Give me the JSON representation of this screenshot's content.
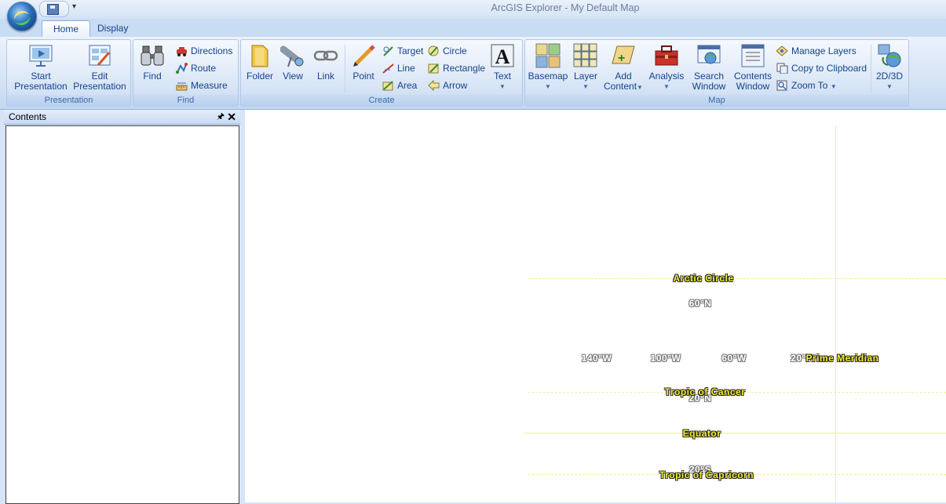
{
  "window": {
    "title": "ArcGIS Explorer - My Default Map"
  },
  "quick_access": {
    "more": "▾"
  },
  "tabs": [
    {
      "label": "Home",
      "active": true
    },
    {
      "label": "Display",
      "active": false
    }
  ],
  "groups": {
    "presentation": {
      "label": "Presentation",
      "start_line1": "Start",
      "start_line2": "Presentation",
      "edit_line1": "Edit",
      "edit_line2": "Presentation"
    },
    "find": {
      "label": "Find",
      "find": "Find",
      "directions": "Directions",
      "route": "Route",
      "measure": "Measure"
    },
    "create": {
      "label": "Create",
      "folder": "Folder",
      "view": "View",
      "link": "Link",
      "point": "Point",
      "target": "Target",
      "line": "Line",
      "area": "Area",
      "circle": "Circle",
      "rectangle": "Rectangle",
      "arrow": "Arrow",
      "text": "Text"
    },
    "map": {
      "label": "Map",
      "basemap": "Basemap",
      "layer": "Layer",
      "add_line1": "Add",
      "add_line2": "Content",
      "analysis": "Analysis",
      "search_line1": "Search",
      "search_line2": "Window",
      "contents_line1": "Contents",
      "contents_line2": "Window",
      "manage_layers": "Manage Layers",
      "copy_clipboard": "Copy to Clipboard",
      "zoom_to": "Zoom To",
      "two_d_three_d": "2D/3D"
    }
  },
  "contents_panel": {
    "title": "Contents",
    "pin": "🖈",
    "close": "✕"
  },
  "map": {
    "arctic_circle": "Arctic Circle",
    "tropic_cancer": "Tropic of Cancer",
    "equator": "Equator",
    "tropic_capricorn": "Tropic of Capricorn",
    "prime_meridian": "Prime Meridian",
    "lat_60n": "60°N",
    "lat_20n": "20°N",
    "lat_20s": "20°S",
    "lon_140w": "140°W",
    "lon_100w": "100°W",
    "lon_60w": "60°W",
    "lon_20w": "20°W"
  },
  "colors": {
    "ribbon_bg": "#d6e4f5",
    "accent_text": "#15428b",
    "map_label": "#f5ee2a"
  }
}
